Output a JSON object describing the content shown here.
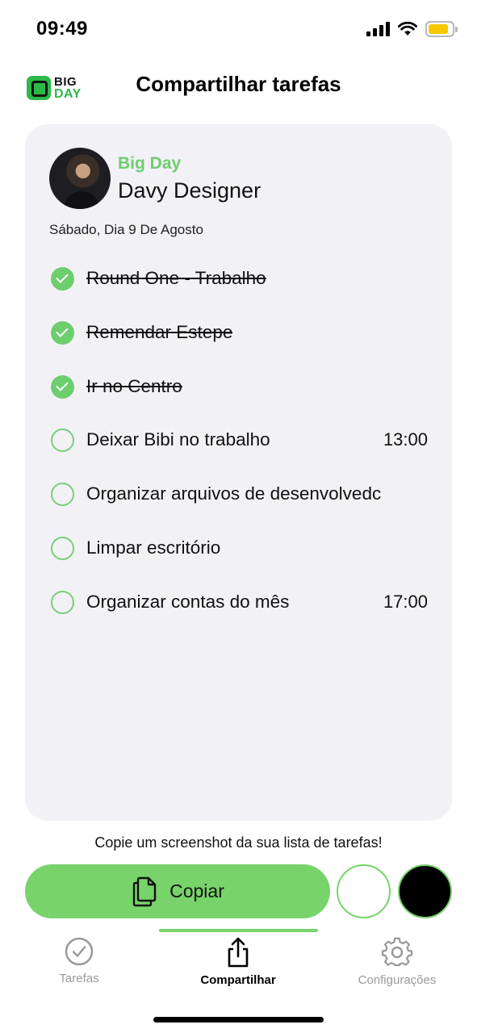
{
  "status_bar": {
    "time": "09:49",
    "battery_color": "#f7c800"
  },
  "header": {
    "logo": {
      "line1": "BIG",
      "line2": "DAY"
    },
    "title": "Compartilhar tarefas"
  },
  "card": {
    "brand": "Big Day",
    "user_name": "Davy Designer",
    "date": "Sábado, Dia 9 De Agosto",
    "tasks": [
      {
        "label": "Round One - Trabalho",
        "time": "",
        "done": true
      },
      {
        "label": "Remendar Estepe",
        "time": "",
        "done": true
      },
      {
        "label": "Ir no Centro",
        "time": "",
        "done": true
      },
      {
        "label": "Deixar Bibi no trabalho",
        "time": "13:00",
        "done": false
      },
      {
        "label": "Organizar arquivos de desenvolvedc",
        "time": "",
        "done": false
      },
      {
        "label": "Limpar escritório",
        "time": "",
        "done": false
      },
      {
        "label": "Organizar contas do mês",
        "time": "17:00",
        "done": false
      }
    ]
  },
  "hint": "Copie um screenshot da sua lista de tarefas!",
  "actions": {
    "copy_label": "Copiar"
  },
  "tabs": [
    {
      "label": "Tarefas",
      "icon": "check-circle-icon",
      "active": false
    },
    {
      "label": "Compartilhar",
      "icon": "share-icon",
      "active": true
    },
    {
      "label": "Configurações",
      "icon": "gear-icon",
      "active": false
    }
  ],
  "colors": {
    "accent": "#78d36b",
    "card_bg": "#f2f1f6",
    "brand_text": "#6dce6d"
  }
}
